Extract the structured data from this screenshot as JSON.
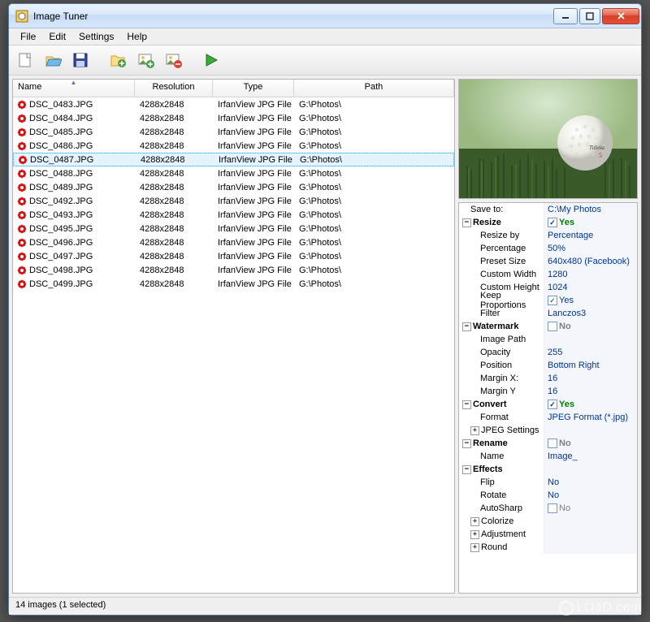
{
  "window": {
    "title": "Image Tuner"
  },
  "menus": {
    "file": "File",
    "edit": "Edit",
    "settings": "Settings",
    "help": "Help"
  },
  "columns": {
    "name": "Name",
    "resolution": "Resolution",
    "type": "Type",
    "path": "Path"
  },
  "files": [
    {
      "name": "DSC_0483.JPG",
      "res": "4288x2848",
      "type": "IrfanView JPG File",
      "path": "G:\\Photos\\",
      "sel": false
    },
    {
      "name": "DSC_0484.JPG",
      "res": "4288x2848",
      "type": "IrfanView JPG File",
      "path": "G:\\Photos\\",
      "sel": false
    },
    {
      "name": "DSC_0485.JPG",
      "res": "4288x2848",
      "type": "IrfanView JPG File",
      "path": "G:\\Photos\\",
      "sel": false
    },
    {
      "name": "DSC_0486.JPG",
      "res": "4288x2848",
      "type": "IrfanView JPG File",
      "path": "G:\\Photos\\",
      "sel": false
    },
    {
      "name": "DSC_0487.JPG",
      "res": "4288x2848",
      "type": "IrfanView JPG File",
      "path": "G:\\Photos\\",
      "sel": true
    },
    {
      "name": "DSC_0488.JPG",
      "res": "4288x2848",
      "type": "IrfanView JPG File",
      "path": "G:\\Photos\\",
      "sel": false
    },
    {
      "name": "DSC_0489.JPG",
      "res": "4288x2848",
      "type": "IrfanView JPG File",
      "path": "G:\\Photos\\",
      "sel": false
    },
    {
      "name": "DSC_0492.JPG",
      "res": "4288x2848",
      "type": "IrfanView JPG File",
      "path": "G:\\Photos\\",
      "sel": false
    },
    {
      "name": "DSC_0493.JPG",
      "res": "4288x2848",
      "type": "IrfanView JPG File",
      "path": "G:\\Photos\\",
      "sel": false
    },
    {
      "name": "DSC_0495.JPG",
      "res": "4288x2848",
      "type": "IrfanView JPG File",
      "path": "G:\\Photos\\",
      "sel": false
    },
    {
      "name": "DSC_0496.JPG",
      "res": "4288x2848",
      "type": "IrfanView JPG File",
      "path": "G:\\Photos\\",
      "sel": false
    },
    {
      "name": "DSC_0497.JPG",
      "res": "4288x2848",
      "type": "IrfanView JPG File",
      "path": "G:\\Photos\\",
      "sel": false
    },
    {
      "name": "DSC_0498.JPG",
      "res": "4288x2848",
      "type": "IrfanView JPG File",
      "path": "G:\\Photos\\",
      "sel": false
    },
    {
      "name": "DSC_0499.JPG",
      "res": "4288x2848",
      "type": "IrfanView JPG File",
      "path": "G:\\Photos\\",
      "sel": false
    }
  ],
  "props": {
    "save_to_label": "Save to:",
    "save_to": "C:\\My Photos",
    "resize": {
      "label": "Resize",
      "enabled": "Yes",
      "resize_by_label": "Resize by",
      "resize_by": "Percentage",
      "percentage_label": "Percentage",
      "percentage": "50%",
      "preset_label": "Preset Size",
      "preset": "640x480 (Facebook)",
      "cw_label": "Custom Width",
      "cw": "1280",
      "ch_label": "Custom Height",
      "ch": "1024",
      "keep_label": "Keep Proportions",
      "keep": "Yes",
      "filter_label": "Filter",
      "filter": "Lanczos3"
    },
    "watermark": {
      "label": "Watermark",
      "enabled": "No",
      "ipath_label": "Image Path",
      "ipath": "",
      "opacity_label": "Opacity",
      "opacity": "255",
      "pos_label": "Position",
      "pos": "Bottom Right",
      "mx_label": "Margin X:",
      "mx": "16",
      "my_label": "Margin Y",
      "my": "16"
    },
    "convert": {
      "label": "Convert",
      "enabled": "Yes",
      "format_label": "Format",
      "format": "JPEG Format (*.jpg)",
      "jpeg_label": "JPEG Settings"
    },
    "rename": {
      "label": "Rename",
      "enabled": "No",
      "name_label": "Name",
      "name": "Image_"
    },
    "effects": {
      "label": "Effects",
      "flip_label": "Flip",
      "flip": "No",
      "rotate_label": "Rotate",
      "rotate": "No",
      "sharp_label": "AutoSharp",
      "sharp": "No",
      "color_label": "Colorize",
      "adj_label": "Adjustment",
      "round_label": "Round"
    }
  },
  "status": "14 images (1 selected)",
  "watermark": "LO4D.com"
}
